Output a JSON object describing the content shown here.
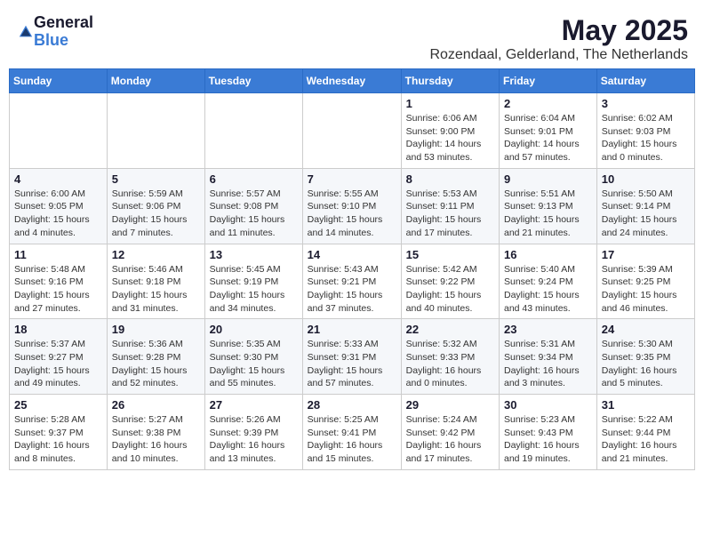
{
  "logo": {
    "general": "General",
    "blue": "Blue"
  },
  "title": "May 2025",
  "subtitle": "Rozendaal, Gelderland, The Netherlands",
  "weekdays": [
    "Sunday",
    "Monday",
    "Tuesday",
    "Wednesday",
    "Thursday",
    "Friday",
    "Saturday"
  ],
  "weeks": [
    [
      {
        "day": "",
        "info": ""
      },
      {
        "day": "",
        "info": ""
      },
      {
        "day": "",
        "info": ""
      },
      {
        "day": "",
        "info": ""
      },
      {
        "day": "1",
        "info": "Sunrise: 6:06 AM\nSunset: 9:00 PM\nDaylight: 14 hours\nand 53 minutes."
      },
      {
        "day": "2",
        "info": "Sunrise: 6:04 AM\nSunset: 9:01 PM\nDaylight: 14 hours\nand 57 minutes."
      },
      {
        "day": "3",
        "info": "Sunrise: 6:02 AM\nSunset: 9:03 PM\nDaylight: 15 hours\nand 0 minutes."
      }
    ],
    [
      {
        "day": "4",
        "info": "Sunrise: 6:00 AM\nSunset: 9:05 PM\nDaylight: 15 hours\nand 4 minutes."
      },
      {
        "day": "5",
        "info": "Sunrise: 5:59 AM\nSunset: 9:06 PM\nDaylight: 15 hours\nand 7 minutes."
      },
      {
        "day": "6",
        "info": "Sunrise: 5:57 AM\nSunset: 9:08 PM\nDaylight: 15 hours\nand 11 minutes."
      },
      {
        "day": "7",
        "info": "Sunrise: 5:55 AM\nSunset: 9:10 PM\nDaylight: 15 hours\nand 14 minutes."
      },
      {
        "day": "8",
        "info": "Sunrise: 5:53 AM\nSunset: 9:11 PM\nDaylight: 15 hours\nand 17 minutes."
      },
      {
        "day": "9",
        "info": "Sunrise: 5:51 AM\nSunset: 9:13 PM\nDaylight: 15 hours\nand 21 minutes."
      },
      {
        "day": "10",
        "info": "Sunrise: 5:50 AM\nSunset: 9:14 PM\nDaylight: 15 hours\nand 24 minutes."
      }
    ],
    [
      {
        "day": "11",
        "info": "Sunrise: 5:48 AM\nSunset: 9:16 PM\nDaylight: 15 hours\nand 27 minutes."
      },
      {
        "day": "12",
        "info": "Sunrise: 5:46 AM\nSunset: 9:18 PM\nDaylight: 15 hours\nand 31 minutes."
      },
      {
        "day": "13",
        "info": "Sunrise: 5:45 AM\nSunset: 9:19 PM\nDaylight: 15 hours\nand 34 minutes."
      },
      {
        "day": "14",
        "info": "Sunrise: 5:43 AM\nSunset: 9:21 PM\nDaylight: 15 hours\nand 37 minutes."
      },
      {
        "day": "15",
        "info": "Sunrise: 5:42 AM\nSunset: 9:22 PM\nDaylight: 15 hours\nand 40 minutes."
      },
      {
        "day": "16",
        "info": "Sunrise: 5:40 AM\nSunset: 9:24 PM\nDaylight: 15 hours\nand 43 minutes."
      },
      {
        "day": "17",
        "info": "Sunrise: 5:39 AM\nSunset: 9:25 PM\nDaylight: 15 hours\nand 46 minutes."
      }
    ],
    [
      {
        "day": "18",
        "info": "Sunrise: 5:37 AM\nSunset: 9:27 PM\nDaylight: 15 hours\nand 49 minutes."
      },
      {
        "day": "19",
        "info": "Sunrise: 5:36 AM\nSunset: 9:28 PM\nDaylight: 15 hours\nand 52 minutes."
      },
      {
        "day": "20",
        "info": "Sunrise: 5:35 AM\nSunset: 9:30 PM\nDaylight: 15 hours\nand 55 minutes."
      },
      {
        "day": "21",
        "info": "Sunrise: 5:33 AM\nSunset: 9:31 PM\nDaylight: 15 hours\nand 57 minutes."
      },
      {
        "day": "22",
        "info": "Sunrise: 5:32 AM\nSunset: 9:33 PM\nDaylight: 16 hours\nand 0 minutes."
      },
      {
        "day": "23",
        "info": "Sunrise: 5:31 AM\nSunset: 9:34 PM\nDaylight: 16 hours\nand 3 minutes."
      },
      {
        "day": "24",
        "info": "Sunrise: 5:30 AM\nSunset: 9:35 PM\nDaylight: 16 hours\nand 5 minutes."
      }
    ],
    [
      {
        "day": "25",
        "info": "Sunrise: 5:28 AM\nSunset: 9:37 PM\nDaylight: 16 hours\nand 8 minutes."
      },
      {
        "day": "26",
        "info": "Sunrise: 5:27 AM\nSunset: 9:38 PM\nDaylight: 16 hours\nand 10 minutes."
      },
      {
        "day": "27",
        "info": "Sunrise: 5:26 AM\nSunset: 9:39 PM\nDaylight: 16 hours\nand 13 minutes."
      },
      {
        "day": "28",
        "info": "Sunrise: 5:25 AM\nSunset: 9:41 PM\nDaylight: 16 hours\nand 15 minutes."
      },
      {
        "day": "29",
        "info": "Sunrise: 5:24 AM\nSunset: 9:42 PM\nDaylight: 16 hours\nand 17 minutes."
      },
      {
        "day": "30",
        "info": "Sunrise: 5:23 AM\nSunset: 9:43 PM\nDaylight: 16 hours\nand 19 minutes."
      },
      {
        "day": "31",
        "info": "Sunrise: 5:22 AM\nSunset: 9:44 PM\nDaylight: 16 hours\nand 21 minutes."
      }
    ]
  ]
}
